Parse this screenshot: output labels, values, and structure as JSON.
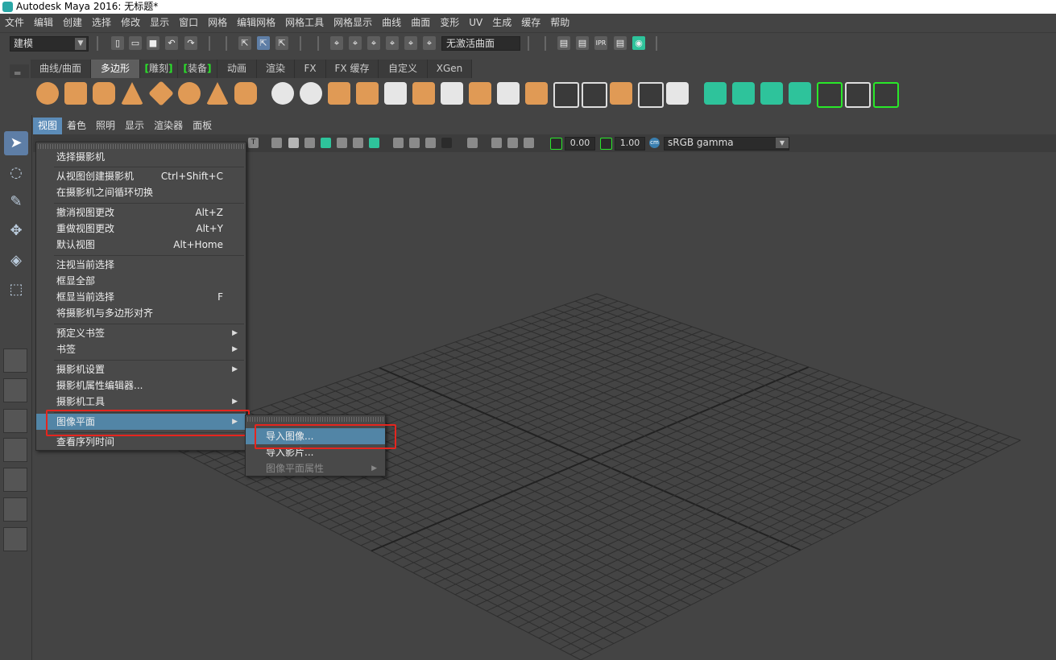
{
  "window": {
    "title": "Autodesk Maya 2016: 无标题*"
  },
  "menubar": [
    "文件",
    "编辑",
    "创建",
    "选择",
    "修改",
    "显示",
    "窗口",
    "网格",
    "编辑网格",
    "网格工具",
    "网格显示",
    "曲线",
    "曲面",
    "变形",
    "UV",
    "生成",
    "缓存",
    "帮助"
  ],
  "statusline": {
    "mode": "建模",
    "live_surface": "无激活曲面",
    "ipr_label": "IPR"
  },
  "shelf": {
    "tabs": [
      {
        "label": "曲线/曲面"
      },
      {
        "label": "多边形"
      },
      {
        "label": "雕刻"
      },
      {
        "label": "装备"
      },
      {
        "label": "动画"
      },
      {
        "label": "渲染"
      },
      {
        "label": "FX"
      },
      {
        "label": "FX 缓存"
      },
      {
        "label": "自定义"
      },
      {
        "label": "XGen"
      }
    ],
    "active_tab": "多边形"
  },
  "panel": {
    "menus": [
      "视图",
      "着色",
      "照明",
      "显示",
      "渲染器",
      "面板"
    ],
    "active_menu": "视图",
    "exposure": "0.00",
    "gamma": "1.00",
    "colorspace": "sRGB gamma",
    "aa_text": "T",
    "cs_badge": "cm"
  },
  "view_menu": {
    "items": [
      {
        "label": "选择摄影机",
        "shortcut": ""
      },
      {
        "label": "从视图创建摄影机",
        "shortcut": "Ctrl+Shift+C"
      },
      {
        "label": "在摄影机之间循环切换",
        "shortcut": ""
      },
      {
        "label": "撤消视图更改",
        "shortcut": "Alt+Z"
      },
      {
        "label": "重做视图更改",
        "shortcut": "Alt+Y"
      },
      {
        "label": "默认视图",
        "shortcut": "Alt+Home"
      },
      {
        "label": "注视当前选择",
        "shortcut": ""
      },
      {
        "label": "框显全部",
        "shortcut": ""
      },
      {
        "label": "框显当前选择",
        "shortcut": "F"
      },
      {
        "label": "将摄影机与多边形对齐",
        "shortcut": ""
      },
      {
        "label": "预定义书签",
        "shortcut": ""
      },
      {
        "label": "书签",
        "shortcut": ""
      },
      {
        "label": "摄影机设置",
        "shortcut": ""
      },
      {
        "label": "摄影机属性编辑器...",
        "shortcut": ""
      },
      {
        "label": "摄影机工具",
        "shortcut": ""
      },
      {
        "label": "图像平面",
        "shortcut": ""
      },
      {
        "label": "查看序列时间",
        "shortcut": ""
      }
    ],
    "highlighted": "图像平面"
  },
  "image_plane_submenu": {
    "items": [
      {
        "label": "导入图像...",
        "enabled": true
      },
      {
        "label": "导入影片...",
        "enabled": true
      },
      {
        "label": "图像平面属性",
        "enabled": false
      }
    ],
    "highlighted": "导入图像..."
  },
  "colors": {
    "highlight": "#5285a6",
    "annotation": "#e5251e",
    "shelf_orange": "#e09a55",
    "shelf_green": "#2ec39b"
  }
}
